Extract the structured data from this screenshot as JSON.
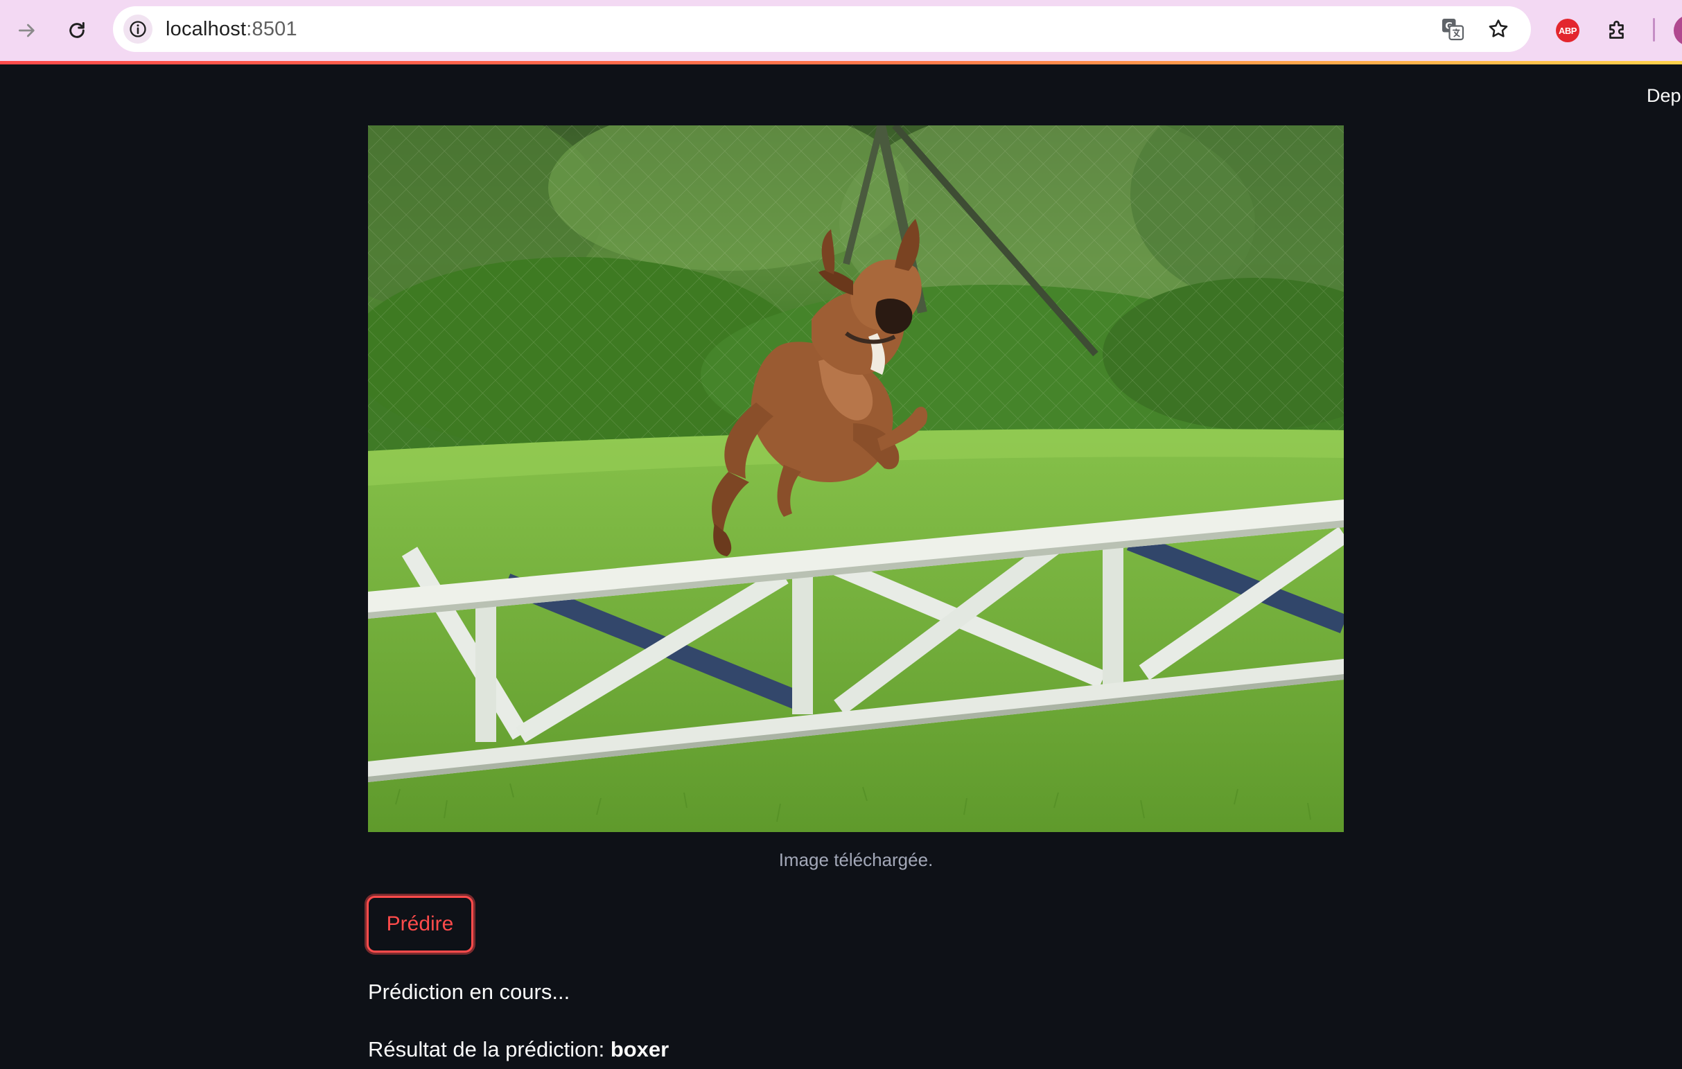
{
  "browser": {
    "url_host": "localhost",
    "url_port": ":8501"
  },
  "app": {
    "deploy_label": "Depl",
    "image_caption": "Image téléchargée.",
    "predict_button_label": "Prédire",
    "status_text": "Prédiction en cours...",
    "result_label": "Résultat de la prédiction: ",
    "result_value": "boxer"
  },
  "colors": {
    "app_background": "#0e1117",
    "primary_accent": "#ff4b4b",
    "text": "#fafafa",
    "caption_text": "#a3a8b8",
    "browser_chrome": "#f3d9f3"
  },
  "icons": {
    "forward": "forward-arrow-icon",
    "reload": "reload-icon",
    "site_info": "info-icon",
    "translate": "translate-icon",
    "bookmark": "bookmark-star-icon",
    "adblock": "adblock-plus-icon",
    "extensions": "puzzle-piece-icon"
  }
}
